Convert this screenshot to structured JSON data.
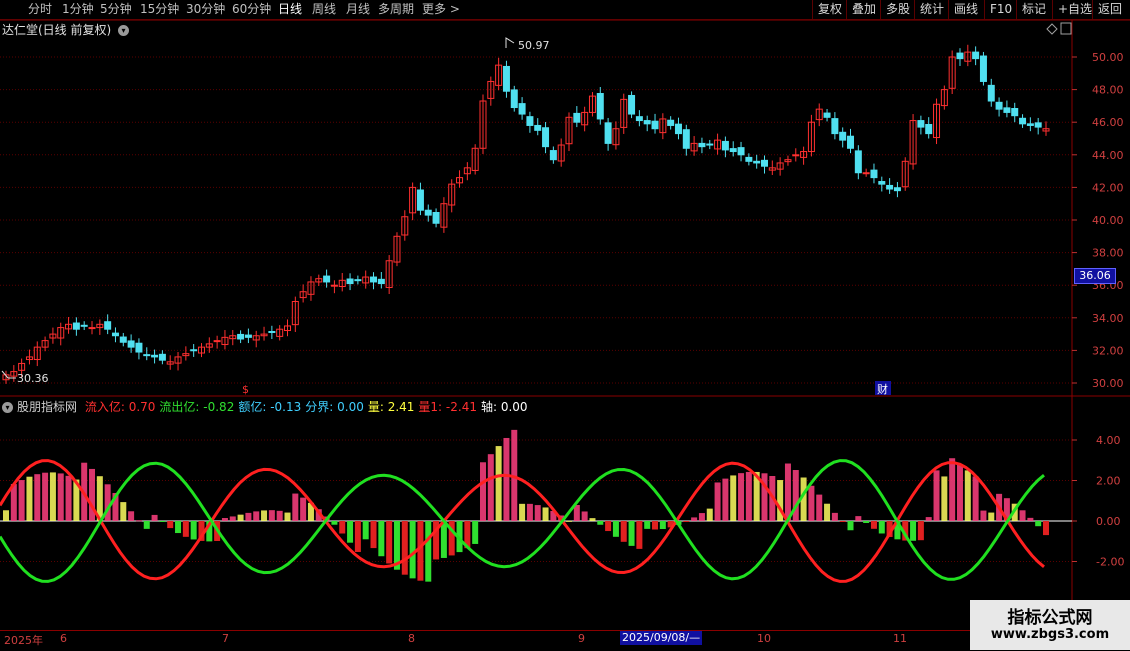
{
  "toolbar": {
    "left_tabs": [
      "分时",
      "1分钟",
      "5分钟",
      "15分钟",
      "30分钟",
      "60分钟",
      "日线",
      "周线",
      "月线",
      "多周期",
      "更多 >"
    ],
    "active_tab": "日线",
    "right_buttons": [
      "复权",
      "叠加",
      "多股",
      "统计",
      "画线",
      "F10",
      "标记",
      "+自选",
      "返回"
    ]
  },
  "price_panel": {
    "title": "达仁堂(日线 前复权)",
    "high_marker": "50.97",
    "low_marker": "30.36",
    "current_price_box": "36.06",
    "y_ticks": [
      "50.00",
      "48.00",
      "46.00",
      "44.00",
      "42.00",
      "40.00",
      "38.00",
      "36.00",
      "34.00",
      "32.00",
      "30.00"
    ],
    "marker_dollar": "$",
    "marker_cai": "财"
  },
  "indicator_panel": {
    "name": "股朋指标网",
    "params": [
      {
        "label": "流入亿:",
        "value": "0.70",
        "color": "#ff3030"
      },
      {
        "label": "流出亿:",
        "value": "-0.82",
        "color": "#30e030"
      },
      {
        "label": "额亿:",
        "value": "-0.13",
        "color": "#40d0ff"
      },
      {
        "label": "分界:",
        "value": "0.00",
        "color": "#40d0ff"
      },
      {
        "label": "量:",
        "value": "2.41",
        "color": "#ffff40"
      },
      {
        "label": "量1:",
        "value": "-2.41",
        "color": "#ff3030"
      },
      {
        "label": "轴:",
        "value": "0.00",
        "color": "#ffffff"
      }
    ],
    "y_ticks": [
      "4.00",
      "2.00",
      "0.00",
      "-2.00"
    ]
  },
  "x_axis": {
    "labels": [
      "2025年",
      "6",
      "7",
      "8",
      "9",
      "10",
      "11"
    ],
    "date_box": "2025/09/08/—"
  },
  "watermark": {
    "line1": "指标公式网",
    "line2": "www.zbgs3.com"
  },
  "colors": {
    "up": "#ff3030",
    "down": "#50e0f0",
    "grid": "#5a0000",
    "inflow_line": "#ff2020",
    "outflow_line": "#20e020"
  },
  "chart_data": {
    "type": "candlestick",
    "y_range": [
      29.5,
      51.5
    ],
    "candles_close": [
      30.5,
      30.7,
      31.2,
      31.6,
      32.2,
      32.6,
      33.0,
      33.4,
      33.6,
      33.3,
      33.5,
      33.4,
      33.6,
      33.3,
      32.9,
      32.5,
      32.2,
      31.9,
      31.7,
      31.6,
      31.4,
      31.3,
      31.6,
      31.8,
      32.0,
      32.2,
      32.4,
      32.6,
      32.8,
      32.9,
      32.7,
      32.8,
      32.9,
      33.0,
      33.1,
      33.3,
      33.5,
      35.0,
      35.6,
      36.2,
      36.4,
      36.2,
      36.0,
      36.3,
      36.1,
      36.3,
      36.5,
      36.2,
      36.1,
      37.5,
      39.0,
      40.2,
      42.0,
      40.6,
      40.3,
      39.8,
      41.0,
      42.2,
      42.6,
      43.2,
      44.4,
      47.3,
      48.5,
      49.5,
      47.9,
      46.9,
      46.5,
      45.8,
      45.5,
      44.5,
      43.7,
      44.6,
      46.3,
      46.0,
      46.6,
      47.6,
      46.2,
      44.7,
      45.6,
      47.4,
      46.5,
      46.1,
      45.9,
      45.6,
      46.2,
      45.8,
      45.3,
      44.4,
      44.7,
      44.5,
      44.6,
      44.9,
      44.3,
      44.2,
      44.0,
      43.6,
      43.5,
      43.3,
      43.2,
      43.5,
      43.7,
      44.0,
      44.2,
      46.0,
      46.8,
      46.3,
      45.3,
      44.9,
      44.4,
      42.9,
      42.9,
      42.6,
      42.2,
      41.9,
      41.8,
      43.6,
      46.1,
      45.7,
      45.3,
      47.1,
      48.0,
      50.0,
      49.9,
      50.3,
      49.9,
      48.5,
      47.3,
      46.8,
      46.6,
      46.4,
      45.9,
      45.8,
      45.7,
      45.6
    ]
  }
}
